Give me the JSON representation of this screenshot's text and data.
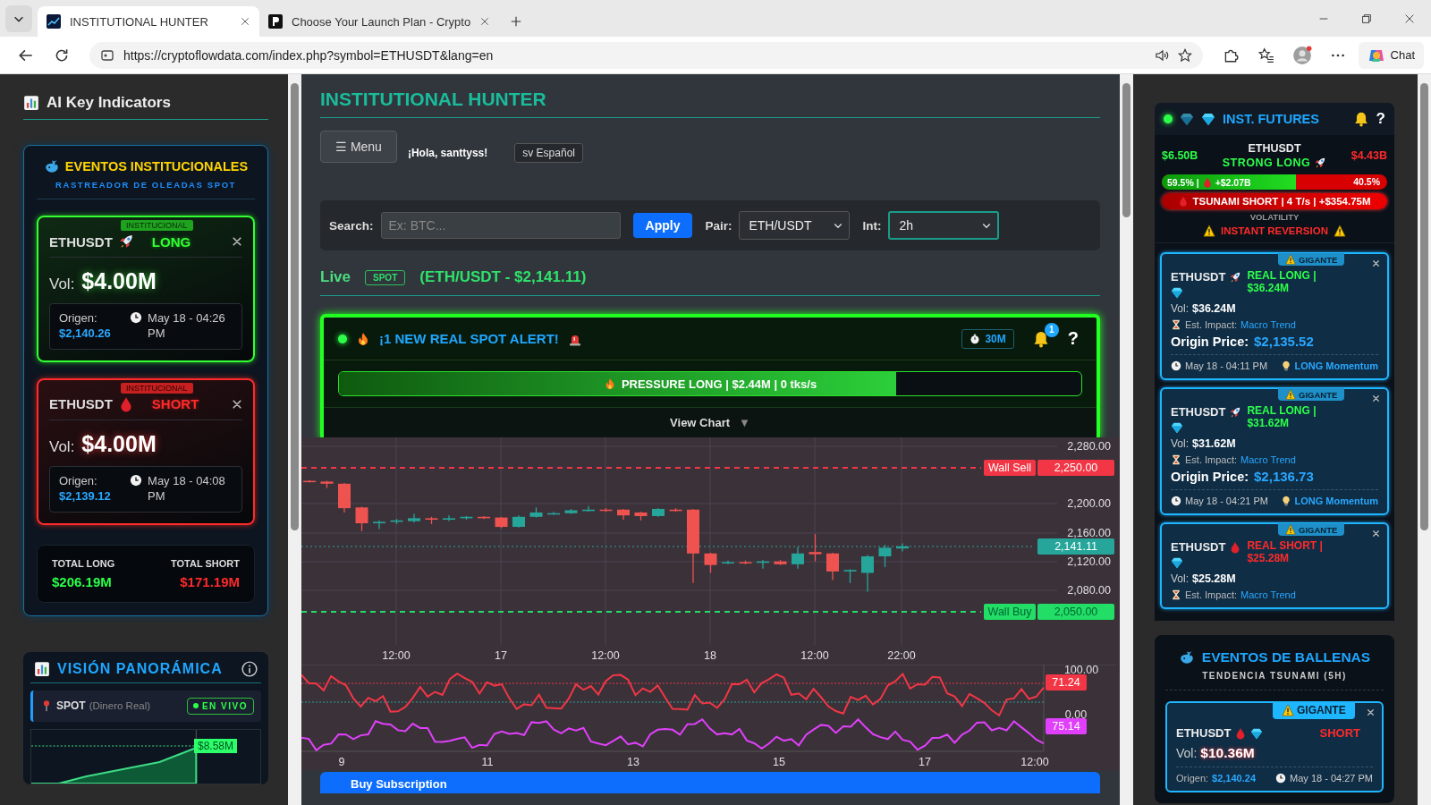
{
  "browser": {
    "tabs": [
      {
        "title": "INSTITUTIONAL HUNTER",
        "selected": true
      },
      {
        "title": "Choose Your Launch Plan - Crypto",
        "selected": false
      }
    ],
    "url": "https://cryptoflowdata.com/index.php?symbol=ETHUSDT&lang=en",
    "chat": "Chat"
  },
  "left": {
    "title": "AI Key Indicators",
    "events": {
      "title": "EVENTOS INSTITUCIONALES",
      "subtitle": "RASTREADOR DE OLEADAS SPOT",
      "items": [
        {
          "symbol": "ETHUSDT",
          "kind": "long",
          "side_label": "LONG",
          "badge": "INSTITUCIONAL",
          "vol_label": "Vol:",
          "vol": "$4.00M",
          "origin_label": "Origen:",
          "origin": "$2,140.26",
          "time": "May 18 - 04:26 PM"
        },
        {
          "symbol": "ETHUSDT",
          "kind": "short",
          "side_label": "SHORT",
          "badge": "INSTITUCIONAL",
          "vol_label": "Vol:",
          "vol": "$4.00M",
          "origin_label": "Origen:",
          "origin": "$2,139.12",
          "time": "May 18 - 04:08 PM"
        }
      ],
      "total_long_label": "TOTAL LONG",
      "total_long": "$206.19M",
      "total_short_label": "TOTAL SHORT",
      "total_short": "$171.19M"
    },
    "panorama": {
      "title": "VISIÓN PANORÁMICA",
      "source": "SPOT",
      "source_note": "(Dinero Real)",
      "live": "EN VIVO",
      "value": "$8.58M"
    }
  },
  "main": {
    "title": "INSTITUTIONAL HUNTER",
    "menu": "☰ Menu",
    "greeting": "¡Hola, santtyss!",
    "language": "sv Español",
    "search": {
      "label": "Search:",
      "placeholder": "Ex: BTC...",
      "apply": "Apply",
      "pair_label": "Pair:",
      "pair": "ETH/USDT",
      "int_label": "Int:",
      "interval": "2h"
    },
    "live": {
      "label": "Live",
      "market": "SPOT",
      "quote": "(ETH/USDT - $2,141.11)"
    },
    "alert": {
      "title": "¡1 NEW REAL SPOT ALERT!",
      "timer": "30M",
      "count": "1",
      "help": "?",
      "pressure": {
        "text": "PRESSURE LONG | $2.44M | 0 tks/s",
        "level": 0.75
      },
      "view_chart": "View Chart",
      "caret": "▼"
    },
    "price_chart": {
      "y_labels": [
        "2,280.00",
        "2,200.00",
        "2,160.00",
        "2,120.00",
        "2,080.00"
      ],
      "current": "2,141.11",
      "wall_sell": {
        "label": "Wall Sell",
        "price": "2,250.00"
      },
      "wall_buy": {
        "label": "Wall Buy",
        "price": "2,050.00"
      },
      "x_labels": [
        "12:00",
        "17",
        "12:00",
        "18",
        "12:00",
        "22:00"
      ]
    },
    "oscillator": {
      "y_labels": [
        "100.00",
        "0.00"
      ],
      "series": [
        {
          "value": "71.24",
          "color": "#f23645"
        },
        {
          "value": "75.14",
          "color": "#e040fb"
        }
      ],
      "x_labels": [
        "9",
        "11",
        "13",
        "15",
        "17",
        "12:00"
      ]
    },
    "subscription": "Buy Subscription"
  },
  "futures": {
    "title": "INST. FUTURES",
    "help": "?",
    "long_total": "$6.50B",
    "symbol": "ETHUSDT",
    "signal": "STRONG LONG",
    "short_total": "$4.43B",
    "ratio": {
      "level": 0.595,
      "long_text": "59.5% |",
      "long_delta": "+$2.07B",
      "short_text": "40.5%"
    },
    "tsunami": "TSUNAMI SHORT | 4 T/s | +$354.75M",
    "volatility_label": "VOLATILITY",
    "volatility": "INSTANT REVERSION",
    "events": [
      {
        "symbol": "ETHUSDT",
        "kind": "long",
        "headline": "REAL LONG | $36.24M",
        "badge": "GIGANTE",
        "vol_label": "Vol:",
        "vol": "$36.24M",
        "impact_label": "Est. Impact:",
        "impact": "Macro Trend",
        "origin_label": "Origin Price:",
        "origin": "$2,135.52",
        "time": "May 18 - 04:11 PM",
        "momentum": "LONG Momentum"
      },
      {
        "symbol": "ETHUSDT",
        "kind": "long",
        "headline": "REAL LONG | $31.62M",
        "badge": "GIGANTE",
        "vol_label": "Vol:",
        "vol": "$31.62M",
        "impact_label": "Est. Impact:",
        "impact": "Macro Trend",
        "origin_label": "Origin Price:",
        "origin": "$2,136.73",
        "time": "May 18 - 04:21 PM",
        "momentum": "LONG Momentum"
      },
      {
        "symbol": "ETHUSDT",
        "kind": "short",
        "headline": "REAL SHORT | $25.28M",
        "badge": "GIGANTE",
        "vol_label": "Vol:",
        "vol": "$25.28M",
        "impact_label": "Est. Impact:",
        "impact": "Macro Trend"
      }
    ]
  },
  "whales": {
    "title": "EVENTOS DE BALLENAS",
    "subtitle": "TENDENCIA TSUNAMI (5H)",
    "items": [
      {
        "symbol": "ETHUSDT",
        "kind": "short",
        "side_label": "SHORT",
        "badge": "GIGANTE",
        "vol_label": "Vol:",
        "vol": "$10.36M",
        "origin_label": "Origen:",
        "origin": "$2,140.24",
        "time": "May 18 - 04:27 PM"
      }
    ]
  }
}
